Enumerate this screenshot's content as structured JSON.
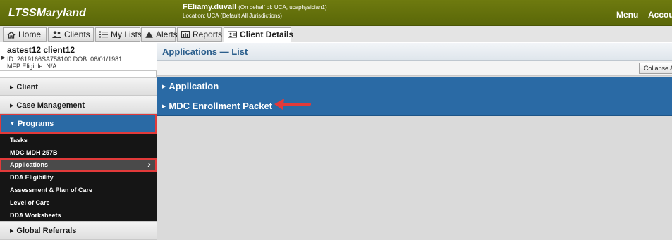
{
  "brand": "LTSSMaryland",
  "user": {
    "name": "FEliamy.duvall",
    "behalf": "(On behalf of: UCA, ucaphysician1)",
    "location": "Location: UCA (Default All Jurisdictions)"
  },
  "top_menu": {
    "menu": "Menu",
    "account": "Accou"
  },
  "tabs": [
    "Home",
    "Clients",
    "My Lists",
    "Alerts",
    "Reports",
    "Client Details"
  ],
  "client": {
    "name": "astest12 client12",
    "id_line": "ID: 2619166SA758100 DOB: 06/01/1981",
    "mfp": "MFP Eligible: N/A"
  },
  "sidebar": {
    "client": "Client",
    "case_management": "Case Management",
    "programs": "Programs",
    "sub_items": [
      "Tasks",
      "MDC MDH 257B",
      "Applications",
      "DDA Eligibility",
      "Assessment & Plan of Care",
      "Level of Care",
      "DDA Worksheets"
    ],
    "global_referrals": "Global Referrals"
  },
  "main": {
    "title": "Applications — List",
    "collapse_all": "Collapse Al",
    "sections": [
      "Application",
      "MDC Enrollment Packet"
    ]
  },
  "colors": {
    "topbar": "#6e7a0f",
    "section_blue": "#2a6aa5",
    "highlight_red": "#e23a3a"
  }
}
